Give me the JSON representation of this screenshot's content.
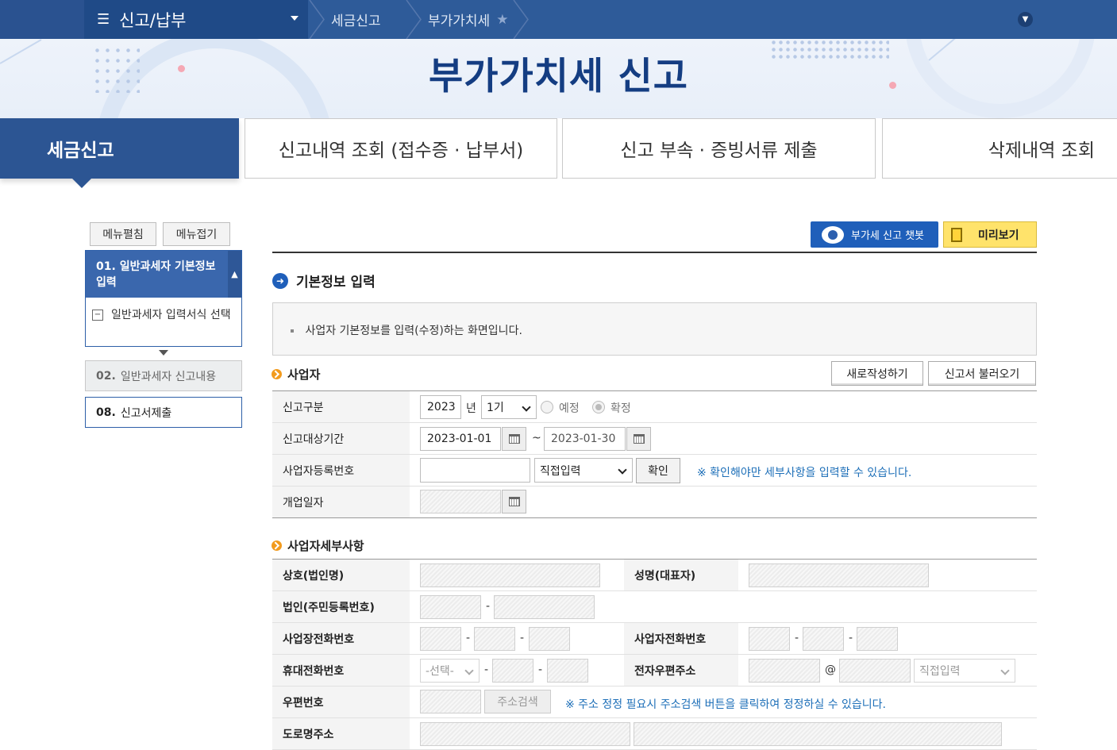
{
  "nav": {
    "menu_label": "신고/납부",
    "crumbs": [
      "세금신고",
      "부가가치세"
    ]
  },
  "banner": {
    "title": "부가가치세 신고"
  },
  "tabs": [
    {
      "label": "세금신고",
      "active": true
    },
    {
      "label": "신고내역 조회 (접수증 · 납부서)"
    },
    {
      "label": "신고 부속 · 증빙서류 제출"
    },
    {
      "label": "삭제내역 조회"
    }
  ],
  "side": {
    "expand_label": "메뉴펼침",
    "collapse_label": "메뉴접기",
    "step1_num": "01.",
    "step1_label": "일반과세자 기본정보 입력",
    "step1_sub": "일반과세자 입력서식 선택",
    "step2_num": "02.",
    "step2_label": "일반과세자 신고내용",
    "step8_num": "08.",
    "step8_label": "신고서제출"
  },
  "actions": {
    "chatbot": "부가세 신고 챗봇",
    "preview": "미리보기"
  },
  "section": {
    "title": "기본정보 입력",
    "info": "사업자 기본정보를 입력(수정)하는 화면입니다."
  },
  "business": {
    "title": "사업자",
    "new_btn": "새로작성하기",
    "load_btn": "신고서 불러오기",
    "rows": {
      "type_label": "신고구분",
      "year": "2023",
      "year_unit": "년",
      "period": "1기",
      "radio_prelim": "예정",
      "radio_final": "확정",
      "period_label": "신고대상기간",
      "date_from": "2023-01-01",
      "tilde": "~",
      "date_to": "2023-01-30",
      "bizno_label": "사업자등록번호",
      "bizno_mode": "직접입력",
      "confirm_btn": "확인",
      "bizno_note": "※ 확인해야만 세부사항을 입력할 수 있습니다.",
      "open_label": "개업일자"
    }
  },
  "detail": {
    "title": "사업자세부사항",
    "trade_name": "상호(법인명)",
    "rep_name": "성명(대표자)",
    "corp_no": "법인(주민등록번호)",
    "biz_phone": "사업장전화번호",
    "owner_phone": "사업자전화번호",
    "mobile": "휴대전화번호",
    "mobile_select": "-선택-",
    "email": "전자우편주소",
    "email_at": "@",
    "email_mode": "직접입력",
    "zip": "우편번호",
    "addr_search": "주소검색",
    "addr_note": "※ 주소 정정 필요시 주소검색 버튼을 클릭하여 정정하실 수 있습니다.",
    "road_addr": "도로명주소",
    "dash": "-"
  }
}
